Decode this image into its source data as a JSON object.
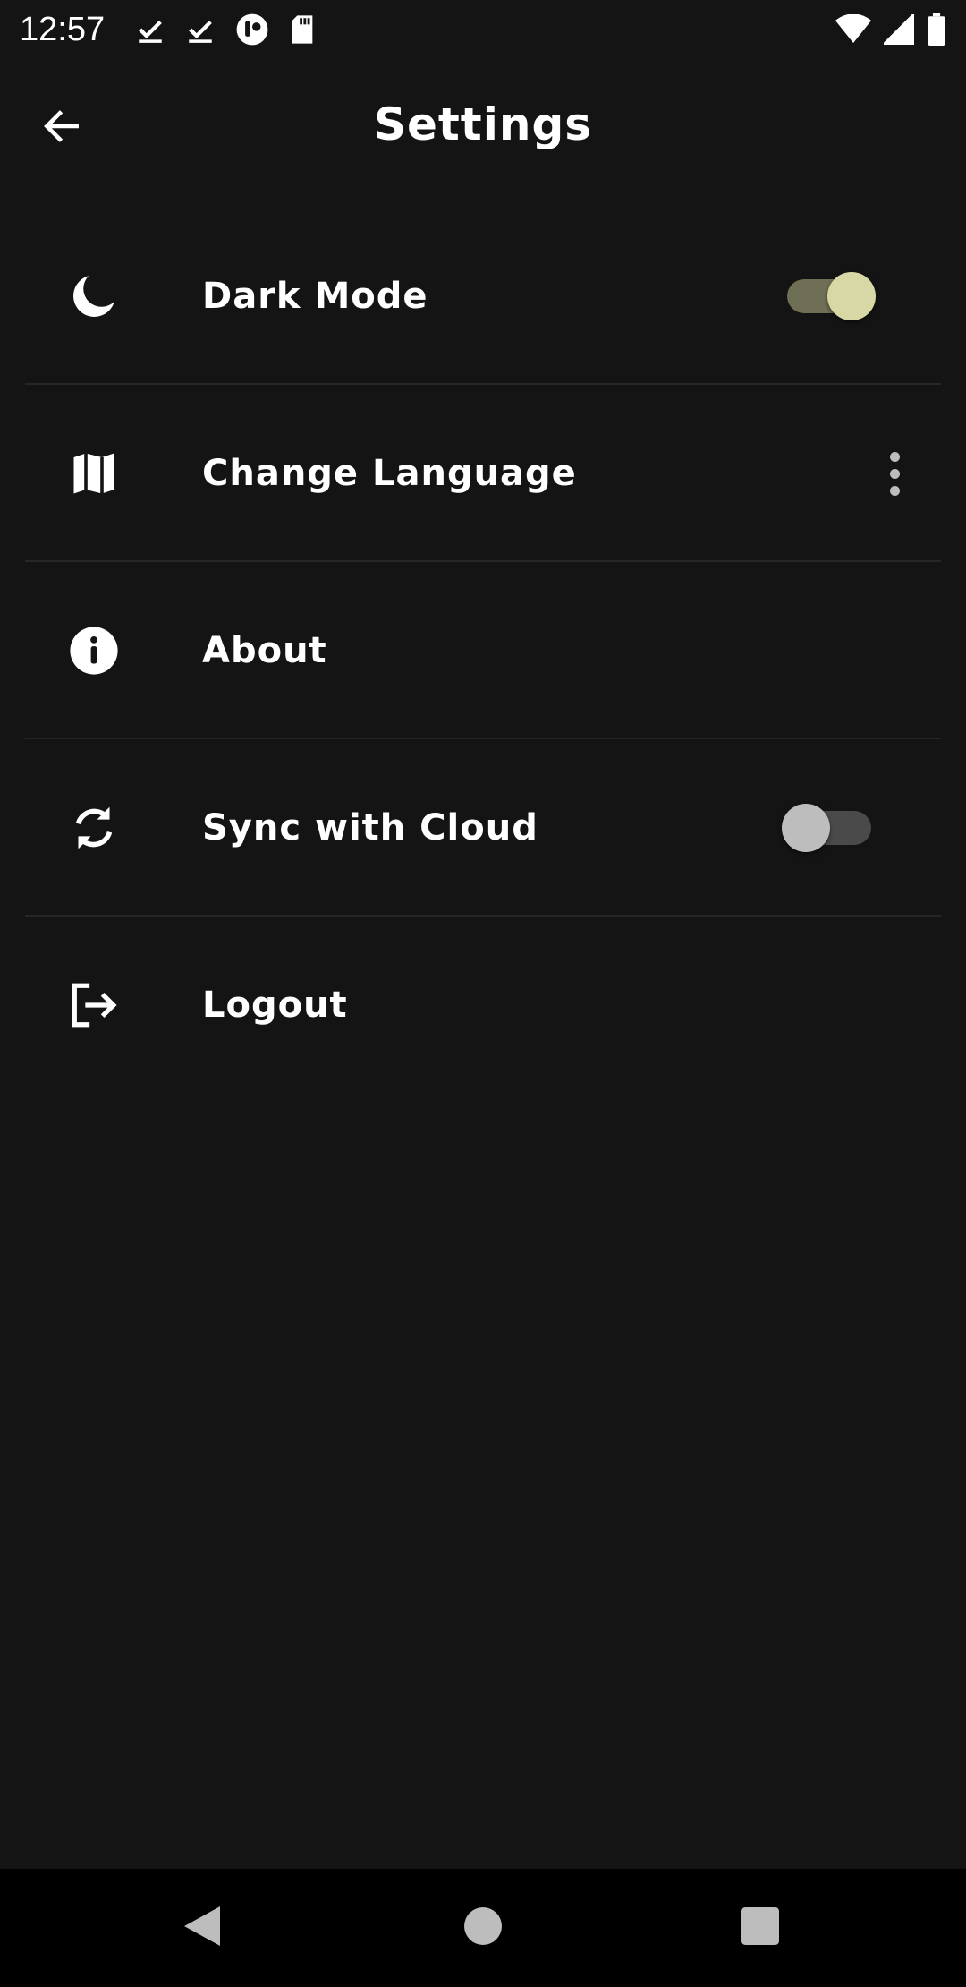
{
  "status_bar": {
    "time": "12:57",
    "left_icons": [
      "download-done-icon",
      "download-done-icon",
      "app-notification-icon",
      "sd-card-icon"
    ],
    "right_icons": [
      "wifi-icon",
      "cellular-signal-icon",
      "battery-icon"
    ]
  },
  "app_bar": {
    "title": "Settings",
    "back_icon": "arrow-left-icon"
  },
  "settings": [
    {
      "icon": "moon-icon",
      "label": "Dark Mode",
      "control": "switch",
      "checked": true
    },
    {
      "icon": "map-icon",
      "label": "Change Language",
      "control": "more-menu"
    },
    {
      "icon": "info-icon",
      "label": "About",
      "control": "none"
    },
    {
      "icon": "sync-icon",
      "label": "Sync with Cloud",
      "control": "switch",
      "checked": false
    },
    {
      "icon": "logout-icon",
      "label": "Logout",
      "control": "none"
    }
  ],
  "colors": {
    "background": "#141414",
    "divider": "#262626",
    "switch_on_thumb": "#d8d8a6",
    "switch_on_track": "#6f6f56",
    "switch_off_thumb": "#bdbdbd",
    "switch_off_track": "#4a4a4a",
    "nav_bar": "#000000"
  },
  "nav_bar": {
    "buttons": [
      "back-triangle-icon",
      "home-circle-icon",
      "recents-square-icon"
    ]
  }
}
